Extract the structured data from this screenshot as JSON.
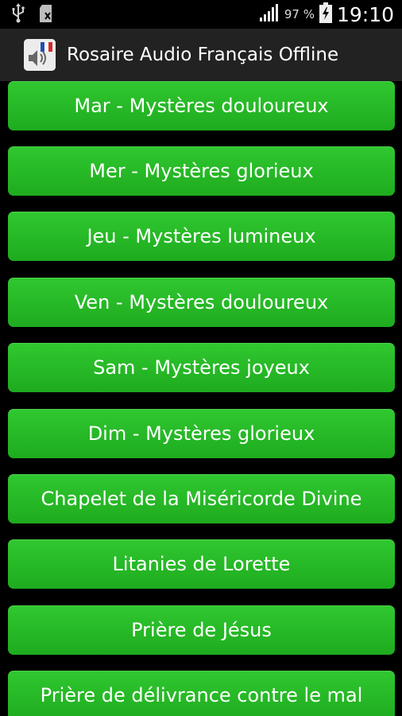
{
  "status_bar": {
    "icons": [
      "usb-icon",
      "sd-card-icon",
      "signal-icon",
      "battery-icon"
    ],
    "battery": "97 %",
    "time": "19:10"
  },
  "action_bar": {
    "title": "Rosaire Audio Français Offline",
    "icon": "app-audio-flag-icon"
  },
  "buttons": [
    "Mar - Mystères douloureux",
    "Mer - Mystères glorieux",
    "Jeu - Mystères lumineux",
    "Ven - Mystères douloureux",
    "Sam - Mystères joyeux",
    "Dim - Mystères glorieux",
    "Chapelet de la Miséricorde Divine",
    "Litanies de Lorette",
    "Prière de Jésus",
    "Prière de délivrance contre le mal"
  ],
  "colors": {
    "button": "#22b422",
    "background": "#000000",
    "action_bar": "#222222"
  }
}
